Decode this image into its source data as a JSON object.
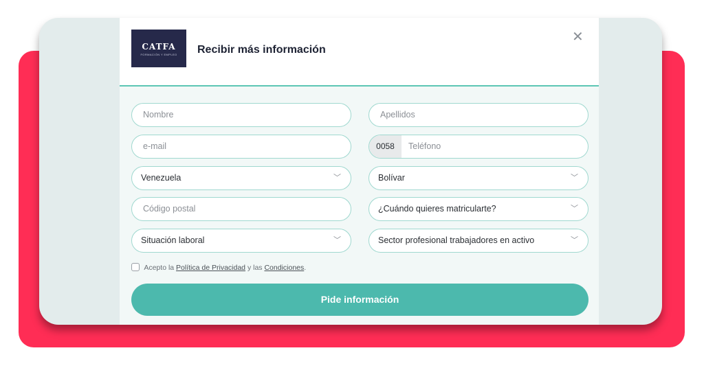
{
  "modal": {
    "logo": {
      "brand": "CATFA",
      "tagline": "FORMACIÓN Y EMPLEO"
    },
    "title": "Recibir más información",
    "close_symbol": "✕"
  },
  "form": {
    "nombre_placeholder": "Nombre",
    "apellidos_placeholder": "Apellidos",
    "email_placeholder": "e-mail",
    "phone_prefix": "0058",
    "phone_placeholder": "Teléfono",
    "pais_value": "Venezuela",
    "estado_value": "Bolívar",
    "codigo_postal_placeholder": "Código postal",
    "matricula_value": "¿Cuándo quieres matricularte?",
    "situacion_value": "Situación laboral",
    "sector_value": "Sector profesional trabajadores en activo",
    "chevron_symbol": "﹀"
  },
  "consent": {
    "prefix": "Acepto la",
    "privacy_link": "Política de Privacidad",
    "middle": "y las",
    "conditions_link": "Condiciones",
    "suffix": "."
  },
  "submit_label": "Pide información",
  "colors": {
    "accent": "#4cb9ad",
    "background_card": "#ff2d55",
    "header_rule": "#5cc5b4",
    "logo_bg": "#26294a"
  }
}
